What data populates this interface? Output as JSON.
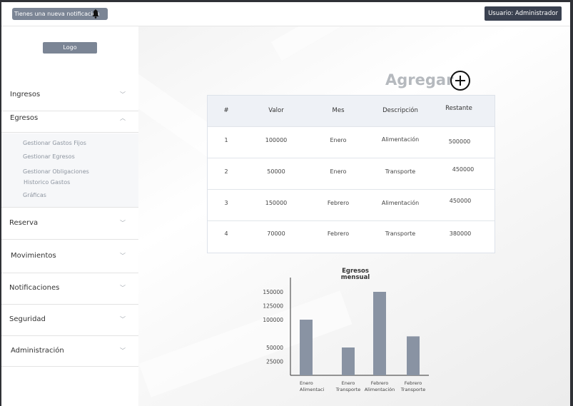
{
  "topbar": {
    "notification_text": "Tienes una nueva notificación",
    "user_label": "Usuario: Administrador"
  },
  "sidebar": {
    "logo_label": "Logo",
    "menu": [
      {
        "label": "Ingresos",
        "expanded": false
      },
      {
        "label": "Egresos",
        "expanded": true
      },
      {
        "label": "Reserva",
        "expanded": false
      },
      {
        "label": "Movimientos",
        "expanded": false
      },
      {
        "label": "Notificaciones",
        "expanded": false
      },
      {
        "label": "Seguridad",
        "expanded": false
      },
      {
        "label": "Administración",
        "expanded": false
      }
    ],
    "egresos_submenu": [
      "Gestionar Gastos Fijos",
      "Gestionar Egresos",
      "Gestionar Obligaciones",
      "Historico Gastos",
      "Gráficas"
    ]
  },
  "main": {
    "add_label": "Agregar",
    "table": {
      "headers": [
        "#",
        "Valor",
        "Mes",
        "Descripción",
        "Restante"
      ],
      "rows": [
        [
          "1",
          "100000",
          "Enero",
          "Alimentación",
          "500000"
        ],
        [
          "2",
          "50000",
          "Enero",
          "Transporte",
          "450000"
        ],
        [
          "3",
          "150000",
          "Febrero",
          "Alimentación",
          "450000"
        ],
        [
          "4",
          "70000",
          "Febrero",
          "Transporte",
          "380000"
        ]
      ]
    }
  },
  "chart_data": {
    "type": "bar",
    "title": "Egresos mensual",
    "title_lines": [
      "Egresos",
      "mensual"
    ],
    "categories": [
      [
        "Enero",
        "Alimentaci"
      ],
      [
        "Enero",
        "Transporte"
      ],
      [
        "Febrero",
        "Alimentación"
      ],
      [
        "Febrero",
        "Transporte"
      ]
    ],
    "values": [
      100000,
      50000,
      150000,
      70000
    ],
    "ytick_labels": [
      "150000",
      "125000",
      "100000",
      "50000",
      "25000"
    ],
    "ytick_values": [
      150000,
      125000,
      100000,
      50000,
      25000
    ],
    "ylim": [
      0,
      150000
    ],
    "bar_color": "#8993a3",
    "grid": false
  },
  "colors": {
    "accent_gray": "#7b8595",
    "user_button": "#3a4150",
    "table_header_bg": "#eef1f6"
  }
}
